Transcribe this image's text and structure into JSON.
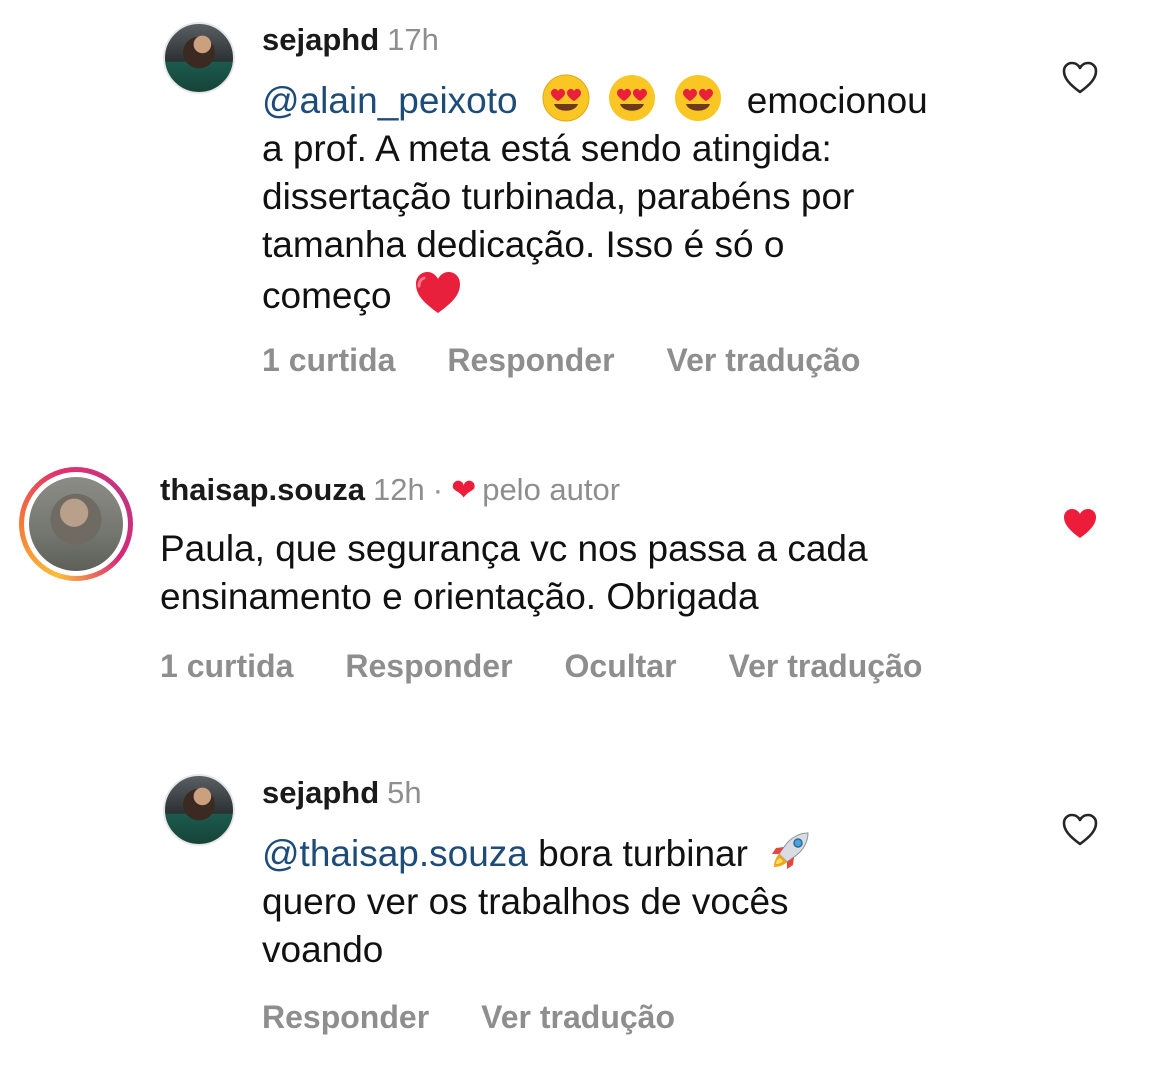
{
  "comments": [
    {
      "username": "sejaphd",
      "time": "17h",
      "mention": "@alain_peixoto",
      "emoji_1": "heart-eyes-emoji",
      "text_after_emoji": "emocionou",
      "lines": [
        "a prof. A meta está sendo atingida:",
        "dissertação turbinada, parabéns por",
        "tamanha dedicação. Isso é só o",
        "começo"
      ],
      "end_emoji": "red-heart-emoji",
      "likes": "1 curtida",
      "reply": "Responder",
      "translate": "Ver tradução",
      "liked": false
    },
    {
      "username": "thaisap.souza",
      "time": "12h",
      "separator": "·",
      "by_author": "pelo autor",
      "lines": [
        "Paula, que segurança vc nos passa a cada",
        "ensinamento e orientação. Obrigada"
      ],
      "likes": "1 curtida",
      "reply": "Responder",
      "hide": "Ocultar",
      "translate": "Ver tradução",
      "liked": true,
      "heart_color": "#ed1c3b"
    },
    {
      "username": "sejaphd",
      "time": "5h",
      "mention": "@thaisap.souza",
      "text_after_mention": "bora turbinar",
      "end_emoji": "rocket-emoji",
      "lines": [
        "quero ver os trabalhos de vocês",
        "voando"
      ],
      "reply": "Responder",
      "translate": "Ver tradução",
      "liked": false
    }
  ],
  "colors": {
    "mention": "#1e4c79",
    "muted": "#8e8e8e",
    "like_red": "#ed1c3b"
  }
}
